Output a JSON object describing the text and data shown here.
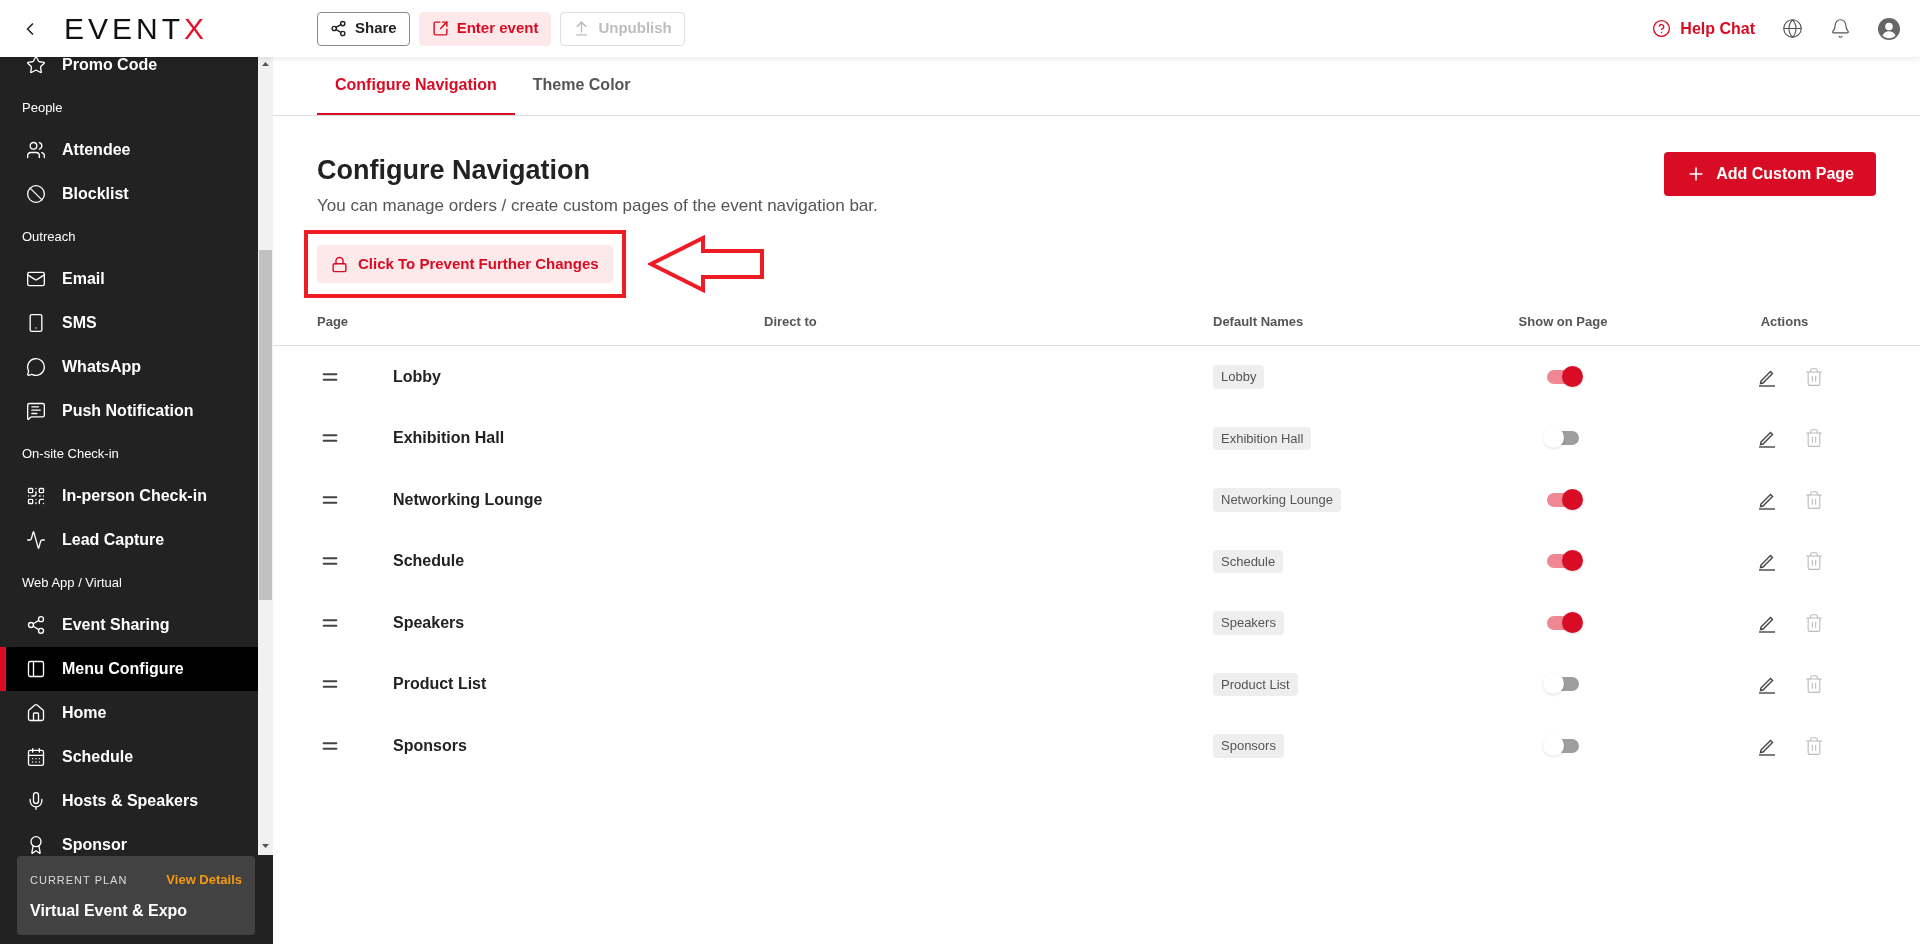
{
  "header": {
    "logo": {
      "main": "EVENT",
      "accent": "X"
    },
    "buttons": [
      {
        "label": "Share",
        "kind": "outline"
      },
      {
        "label": "Enter event",
        "kind": "tinted"
      },
      {
        "label": "Unpublish",
        "kind": "disabled"
      }
    ],
    "help": "Help Chat"
  },
  "sidebar": {
    "items": [
      {
        "label": "Promo Code",
        "kind": "item",
        "selected": false
      },
      {
        "label": "People",
        "kind": "section"
      },
      {
        "label": "Attendee",
        "kind": "item",
        "selected": false
      },
      {
        "label": "Blocklist",
        "kind": "item",
        "selected": false
      },
      {
        "label": "Outreach",
        "kind": "section"
      },
      {
        "label": "Email",
        "kind": "item",
        "selected": false
      },
      {
        "label": "SMS",
        "kind": "item",
        "selected": false
      },
      {
        "label": "WhatsApp",
        "kind": "item",
        "selected": false
      },
      {
        "label": "Push Notification",
        "kind": "item",
        "selected": false
      },
      {
        "label": "On-site Check-in",
        "kind": "section"
      },
      {
        "label": "In-person Check-in",
        "kind": "item",
        "selected": false
      },
      {
        "label": "Lead Capture",
        "kind": "item",
        "selected": false
      },
      {
        "label": "Web App / Virtual",
        "kind": "section"
      },
      {
        "label": "Event Sharing",
        "kind": "item",
        "selected": false
      },
      {
        "label": "Menu Configure",
        "kind": "item",
        "selected": true
      },
      {
        "label": "Home",
        "kind": "item",
        "selected": false
      },
      {
        "label": "Schedule",
        "kind": "item",
        "selected": false
      },
      {
        "label": "Hosts & Speakers",
        "kind": "item",
        "selected": false
      },
      {
        "label": "Sponsor",
        "kind": "item",
        "selected": false
      }
    ],
    "plan": {
      "caption": "CURRENT PLAN",
      "link": "View Details",
      "name": "Virtual Event & Expo"
    }
  },
  "tabs": [
    {
      "label": "Configure Navigation",
      "selected": true
    },
    {
      "label": "Theme Color",
      "selected": false
    }
  ],
  "page": {
    "title": "Configure Navigation",
    "subtitle": "You can manage orders / create custom pages of the event navigation bar.",
    "add_button": "Add Custom Page",
    "lock_button": "Click To Prevent Further Changes"
  },
  "table": {
    "columns": [
      "Page",
      "Direct to",
      "Default Names",
      "Show on Page",
      "Actions"
    ],
    "rows": [
      {
        "page": "Lobby",
        "default_name": "Lobby",
        "shown": true
      },
      {
        "page": "Exhibition Hall",
        "default_name": "Exhibition Hall",
        "shown": false
      },
      {
        "page": "Networking Lounge",
        "default_name": "Networking Lounge",
        "shown": true
      },
      {
        "page": "Schedule",
        "default_name": "Schedule",
        "shown": true
      },
      {
        "page": "Speakers",
        "default_name": "Speakers",
        "shown": true
      },
      {
        "page": "Product List",
        "default_name": "Product List",
        "shown": false
      },
      {
        "page": "Sponsors",
        "default_name": "Sponsors",
        "shown": false
      }
    ]
  }
}
